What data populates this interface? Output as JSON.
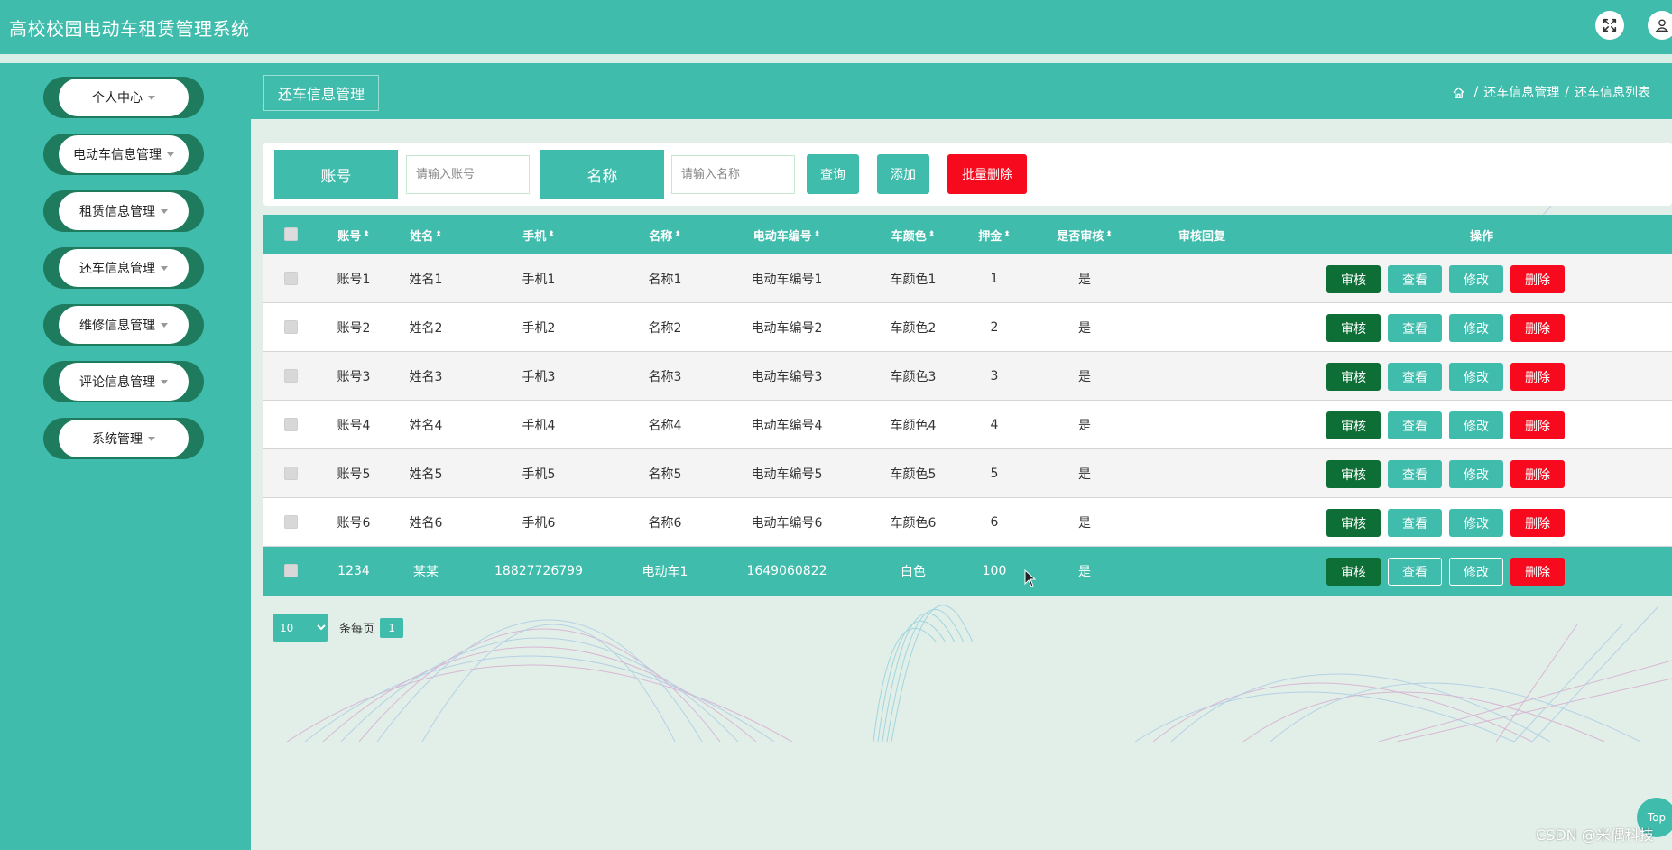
{
  "app": {
    "title": "高校校园电动车租赁管理系统"
  },
  "header": {
    "fullscreen_icon": "fullscreen-icon",
    "user_icon": "user-icon"
  },
  "sidebar": {
    "items": [
      {
        "label": "个人中心"
      },
      {
        "label": "电动车信息管理"
      },
      {
        "label": "租赁信息管理"
      },
      {
        "label": "还车信息管理"
      },
      {
        "label": "维修信息管理"
      },
      {
        "label": "评论信息管理"
      },
      {
        "label": "系统管理"
      }
    ]
  },
  "page": {
    "title": "还车信息管理",
    "breadcrumb": {
      "home_icon": "home-icon",
      "sep": "/",
      "level1": "还车信息管理",
      "level2": "还车信息列表"
    }
  },
  "search": {
    "account_label": "账号",
    "account_placeholder": "请输入账号",
    "name_label": "名称",
    "name_placeholder": "请输入名称",
    "query_btn": "查询",
    "add_btn": "添加",
    "batch_delete_btn": "批量删除"
  },
  "table": {
    "columns": [
      "账号",
      "姓名",
      "手机",
      "名称",
      "电动车编号",
      "车颜色",
      "押金",
      "是否审核",
      "审核回复",
      "操作"
    ],
    "sort_icon": "⬍",
    "actions": {
      "audit": "审核",
      "view": "查看",
      "edit": "修改",
      "delete": "删除"
    },
    "rows": [
      {
        "account": "账号1",
        "name": "姓名1",
        "phone": "手机1",
        "title": "名称1",
        "bike_no": "电动车编号1",
        "color": "车颜色1",
        "deposit": "1",
        "audited": "是",
        "reply": ""
      },
      {
        "account": "账号2",
        "name": "姓名2",
        "phone": "手机2",
        "title": "名称2",
        "bike_no": "电动车编号2",
        "color": "车颜色2",
        "deposit": "2",
        "audited": "是",
        "reply": ""
      },
      {
        "account": "账号3",
        "name": "姓名3",
        "phone": "手机3",
        "title": "名称3",
        "bike_no": "电动车编号3",
        "color": "车颜色3",
        "deposit": "3",
        "audited": "是",
        "reply": ""
      },
      {
        "account": "账号4",
        "name": "姓名4",
        "phone": "手机4",
        "title": "名称4",
        "bike_no": "电动车编号4",
        "color": "车颜色4",
        "deposit": "4",
        "audited": "是",
        "reply": ""
      },
      {
        "account": "账号5",
        "name": "姓名5",
        "phone": "手机5",
        "title": "名称5",
        "bike_no": "电动车编号5",
        "color": "车颜色5",
        "deposit": "5",
        "audited": "是",
        "reply": ""
      },
      {
        "account": "账号6",
        "name": "姓名6",
        "phone": "手机6",
        "title": "名称6",
        "bike_no": "电动车编号6",
        "color": "车颜色6",
        "deposit": "6",
        "audited": "是",
        "reply": ""
      },
      {
        "account": "1234",
        "name": "某某",
        "phone": "18827726799",
        "title": "电动车1",
        "bike_no": "1649060822",
        "color": "白色",
        "deposit": "100",
        "audited": "是",
        "reply": ""
      }
    ]
  },
  "pagination": {
    "page_size": "10",
    "per_page_label": "条每页",
    "current_page": "1"
  },
  "footer": {
    "top_btn": "Top",
    "watermark": "CSDN @米偶科技"
  },
  "colors": {
    "primary": "#3fbcab",
    "audit": "#0d6e36",
    "danger": "#f70a1d",
    "background": "#e2efe8"
  }
}
